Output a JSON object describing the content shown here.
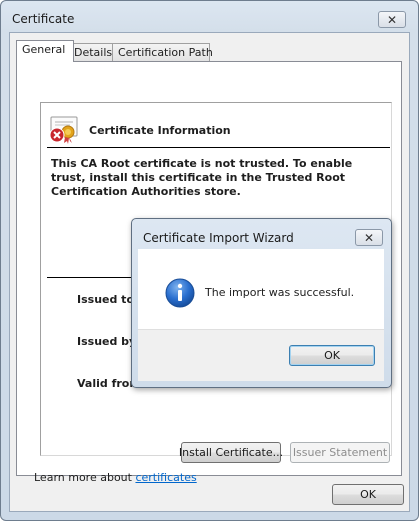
{
  "window": {
    "title": "Certificate",
    "close_glyph": "✕"
  },
  "tabs": [
    {
      "label": "General",
      "active": true
    },
    {
      "label": "Details",
      "active": false
    },
    {
      "label": "Certification Path",
      "active": false
    }
  ],
  "general": {
    "icon": "certificate-error-icon",
    "heading": "Certificate Information",
    "warning": "This CA Root certificate is not trusted. To enable trust, install this certificate in the Trusted Root Certification Authorities store.",
    "fields": [
      {
        "label": "Issued to:"
      },
      {
        "label": "Issued by:"
      },
      {
        "label": "Valid from"
      }
    ],
    "install_button": "Install Certificate...",
    "issuer_button": "Issuer Statement",
    "learn_prefix": "Learn more about ",
    "learn_link": "certificates"
  },
  "footer": {
    "ok_label": "OK"
  },
  "wizard": {
    "title": "Certificate Import Wizard",
    "close_glyph": "✕",
    "icon": "info-icon",
    "message": "The import was successful.",
    "ok_label": "OK"
  },
  "colors": {
    "link": "#0066cc",
    "info_blue": "#1b63c6",
    "error_red": "#c8262d",
    "seal_gold": "#e2a41c"
  }
}
